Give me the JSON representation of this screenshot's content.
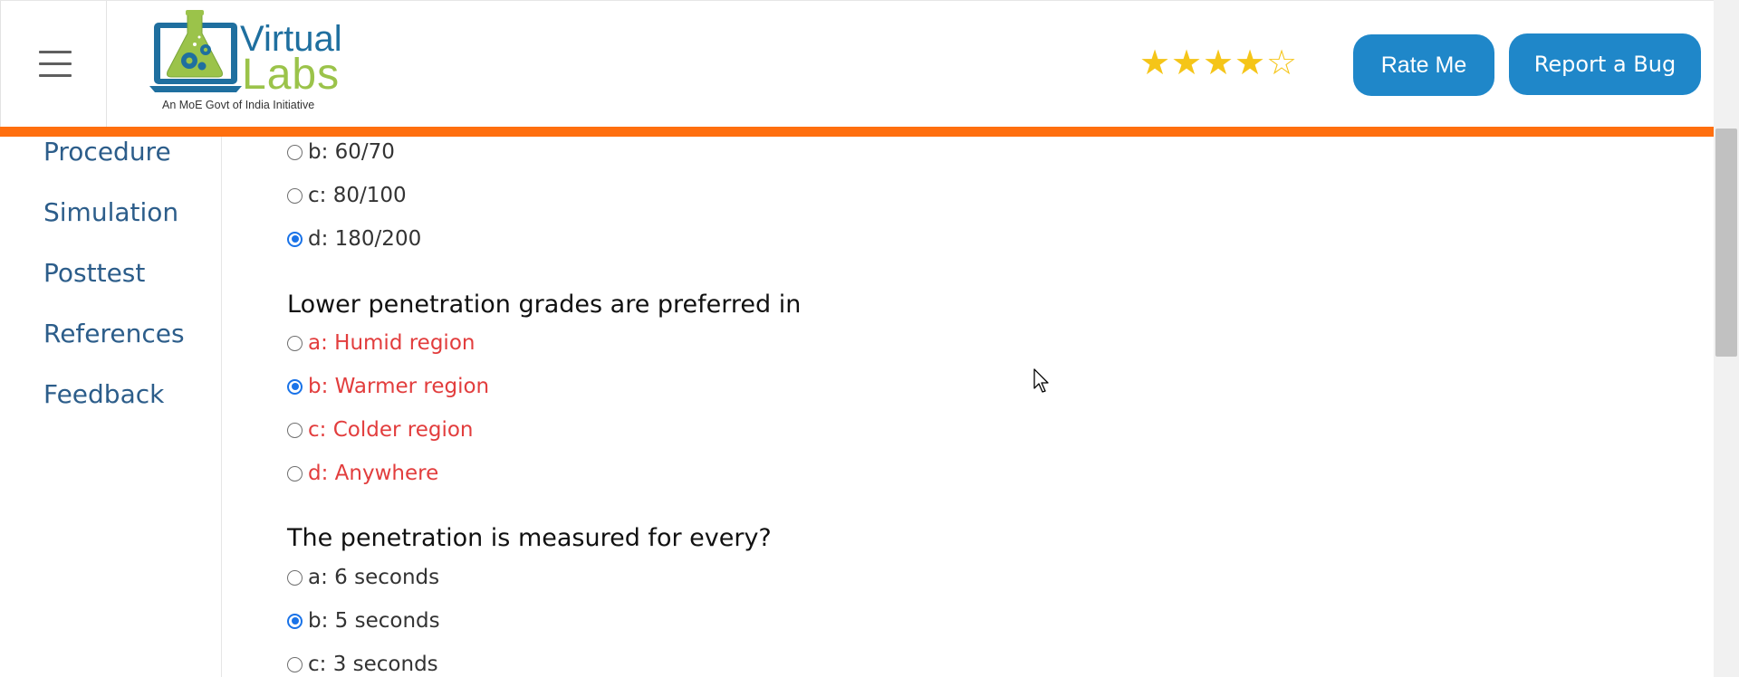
{
  "header": {
    "menu_icon": "hamburger-menu-icon",
    "logo": {
      "word1": "Virtual",
      "word2": "Labs",
      "tagline": "An MoE Govt of India Initiative"
    },
    "rating": {
      "value": 4,
      "max": 5,
      "icons": [
        "star-filled-icon",
        "star-filled-icon",
        "star-filled-icon",
        "star-filled-icon",
        "star-empty-icon"
      ]
    },
    "rate_button": "Rate Me",
    "bug_button": "Report a Bug"
  },
  "sidebar": {
    "items": [
      "Procedure",
      "Simulation",
      "Posttest",
      "References",
      "Feedback"
    ]
  },
  "quiz": {
    "partial_question": {
      "options": [
        {
          "label": "b: 60/70",
          "selected": false,
          "status": "normal"
        },
        {
          "label": "c: 80/100",
          "selected": false,
          "status": "normal"
        },
        {
          "label": "d: 180/200",
          "selected": true,
          "status": "normal"
        }
      ]
    },
    "question2": {
      "text": "Lower penetration grades are preferred in",
      "options": [
        {
          "label": "a: Humid region",
          "selected": false,
          "status": "wrong"
        },
        {
          "label": "b: Warmer region",
          "selected": true,
          "status": "wrong"
        },
        {
          "label": "c: Colder region",
          "selected": false,
          "status": "wrong"
        },
        {
          "label": "d: Anywhere",
          "selected": false,
          "status": "wrong"
        }
      ]
    },
    "question3": {
      "text": "The penetration is measured for every?",
      "options": [
        {
          "label": "a: 6 seconds",
          "selected": false,
          "status": "normal"
        },
        {
          "label": "b: 5 seconds",
          "selected": true,
          "status": "normal"
        },
        {
          "label": "c: 3 seconds",
          "selected": false,
          "status": "normal"
        }
      ]
    }
  },
  "colors": {
    "accent_orange": "#ff6f0f",
    "button_blue": "#1f87c9",
    "wrong_red": "#e23d3d",
    "nav_blue": "#2c5d8a",
    "star_gold": "#f5c518"
  }
}
